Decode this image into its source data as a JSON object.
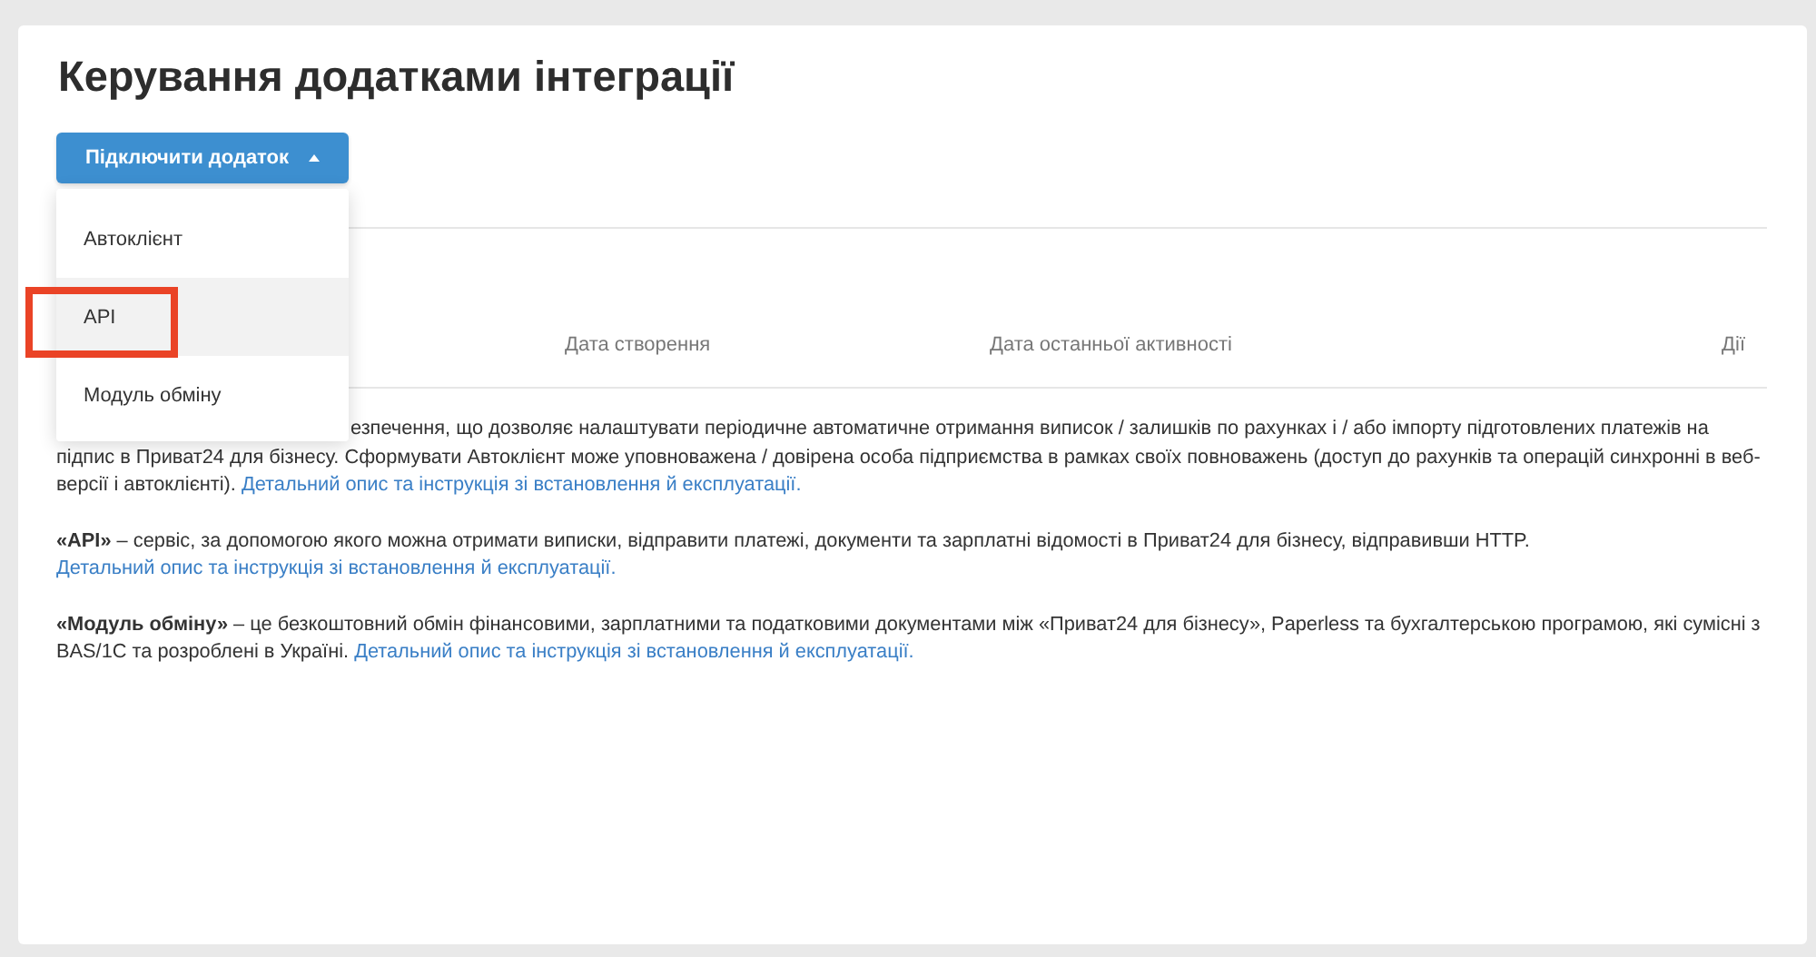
{
  "page": {
    "title": "Керування додатками інтеграції"
  },
  "connect_button": {
    "label": "Підключити додаток",
    "expanded": true
  },
  "menu": {
    "items": [
      {
        "label": "Автоклієнт",
        "selected": false,
        "outlined": false
      },
      {
        "label": "API",
        "selected": true,
        "outlined": true
      },
      {
        "label": "Модуль обміну",
        "selected": false,
        "outlined": false
      }
    ]
  },
  "table": {
    "columns": [
      "Дата створення",
      "Дата останньої активності",
      "Дії"
    ]
  },
  "descriptions": [
    {
      "text": "езпечення, що дозволяє налаштувати періодичне автоматичне отримання виписок / залишків по рахунках і / або імпорту підготовлених платежів на підпис в Приват24 для бізнесу. Сформувати Автоклієнт може уповноважена / довірена особа підприємства в рамках своїх повноважень (доступ до рахунків та операцій синхронні в веб-версії і автоклієнті).",
      "link": "Детальний опис та інструкція зі встановлення й експлуатації."
    },
    {
      "text": "**«API»** – сервіс, за допомогою якого можна отримати виписки, відправити платежі, документи та зарплатні відомості в Приват24 для бізнесу, відправивши HTTP.",
      "link": "Детальний опис та інструкція зі встановлення й експлуатації."
    },
    {
      "text": "**«Модуль обміну»** – це безкоштовний обмін фінансовими, зарплатними та податковими документами між «Приват24 для бізнесу», Paperless та бухгалтерською програмою, які сумісні з BAS/1C та розроблені в Україні.",
      "link": "Детальний опис та інструкція зі встановлення й експлуатації."
    }
  ]
}
